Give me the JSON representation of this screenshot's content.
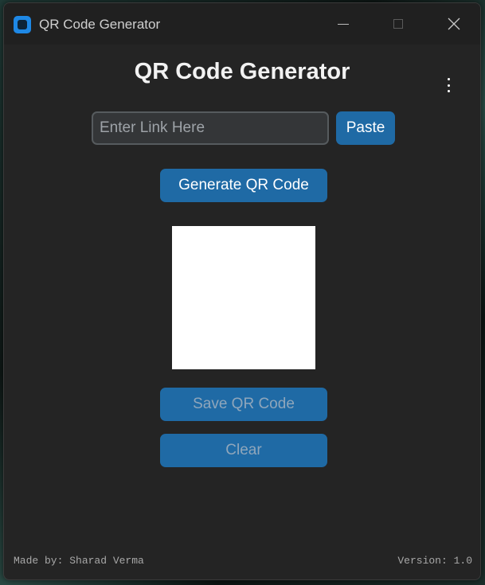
{
  "window": {
    "title": "QR Code Generator",
    "icon": "app-icon"
  },
  "main": {
    "heading": "QR Code Generator",
    "menu_icon": "kebab-menu-icon",
    "link_input": {
      "value": "",
      "placeholder": "Enter Link Here"
    },
    "paste_label": "Paste",
    "generate_label": "Generate QR Code",
    "save_label": "Save QR Code",
    "clear_label": "Clear"
  },
  "footer": {
    "credit": "Made by: Sharad Verma",
    "version": "Version: 1.0"
  },
  "colors": {
    "background": "#242424",
    "accent": "#1f6aa5",
    "input_bg": "#343638",
    "input_border": "#565b5e",
    "qr_area": "#ffffff"
  }
}
